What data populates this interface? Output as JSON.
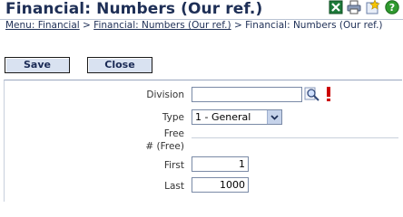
{
  "title": "Financial: Numbers (Our ref.)",
  "title_icons": [
    "excel-icon",
    "print-icon",
    "add-favorite-icon",
    "help-icon"
  ],
  "breadcrumb": {
    "menu": "Menu: Financial",
    "sep": " > ",
    "link2": "Financial: Numbers (Our ref.)",
    "current": "Financial: Numbers (Our ref.)"
  },
  "toolbar": {
    "save_label": "Save",
    "close_label": "Close"
  },
  "form": {
    "division_label": "Division",
    "division_value": "",
    "type_label": "Type",
    "type_value": "1 - General",
    "free_label": "Free",
    "free_num_label": "# (Free)",
    "first_label": "First",
    "first_value": "1",
    "last_label": "Last",
    "last_value": "1000"
  },
  "colors": {
    "title": "#1e2f56",
    "button_bg": "#d9e2f1",
    "required": "#cc0000"
  }
}
